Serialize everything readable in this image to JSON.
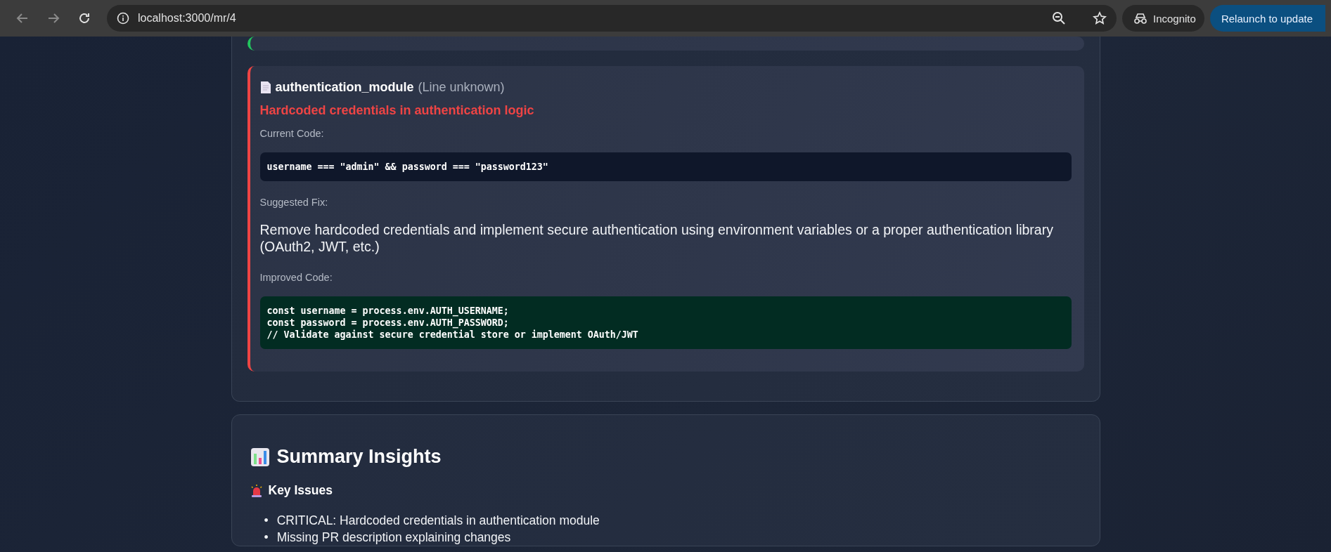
{
  "browser": {
    "url": "localhost:3000/mr/4",
    "profile": "Incognito",
    "update_button": "Relaunch to update"
  },
  "issues": [
    {
      "color": "#22c55e"
    },
    {
      "color": "#ef4444",
      "file": "authentication_module",
      "line": "(Line unknown)",
      "title": "Hardcoded credentials in authentication logic",
      "current_label": "Current Code:",
      "current_code": [
        "username === \"admin\" && password === \"password123\""
      ],
      "fix_label": "Suggested Fix:",
      "fix": "Remove hardcoded credentials and implement secure authentication using environment variables or a proper authentication library (OAuth2, JWT, etc.)",
      "improved_label": "Improved Code:",
      "improved_code": [
        "const username = process.env.AUTH_USERNAME;",
        "const password = process.env.AUTH_PASSWORD;",
        "// Validate against secure credential store or implement OAuth/JWT"
      ]
    }
  ],
  "summary": {
    "title": "Summary Insights",
    "subtitle": "Key Issues",
    "items": [
      {
        "marker": "•",
        "text": "CRITICAL: Hardcoded credentials in authentication module"
      },
      {
        "marker": "•",
        "text": "Missing PR description explaining changes"
      }
    ]
  }
}
